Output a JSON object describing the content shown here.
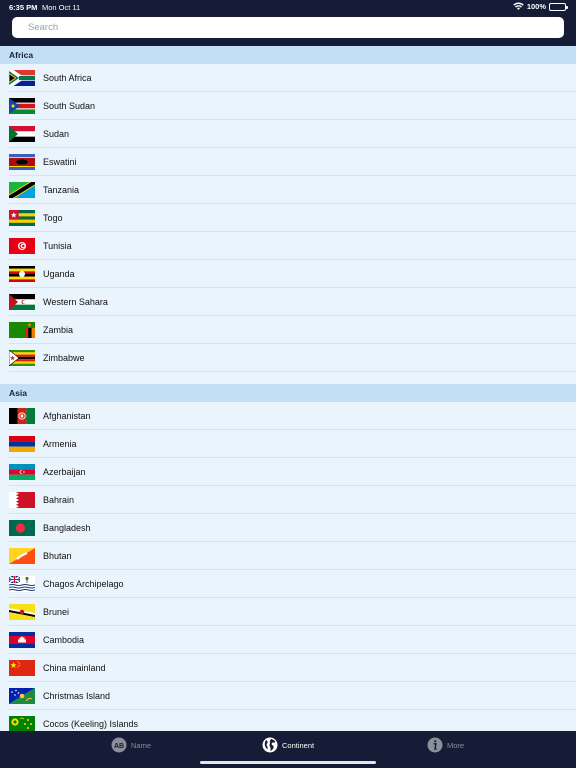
{
  "status_bar": {
    "time": "6:35 PM",
    "date": "Mon Oct 11",
    "battery": "100%"
  },
  "search": {
    "placeholder": "Search"
  },
  "sections": [
    {
      "title": "Africa",
      "countries": [
        "South Africa",
        "South Sudan",
        "Sudan",
        "Eswatini",
        "Tanzania",
        "Togo",
        "Tunisia",
        "Uganda",
        "Western Sahara",
        "Zambia",
        "Zimbabwe"
      ]
    },
    {
      "title": "Asia",
      "countries": [
        "Afghanistan",
        "Armenia",
        "Azerbaijan",
        "Bahrain",
        "Bangladesh",
        "Bhutan",
        "Chagos Archipelago",
        "Brunei",
        "Cambodia",
        "China mainland",
        "Christmas Island",
        "Cocos (Keeling) Islands"
      ]
    }
  ],
  "tabs": [
    {
      "label": "Name",
      "icon": "ab-icon",
      "active": false
    },
    {
      "label": "Continent",
      "icon": "globe-icon",
      "active": true
    },
    {
      "label": "More",
      "icon": "info-icon",
      "active": false
    }
  ]
}
